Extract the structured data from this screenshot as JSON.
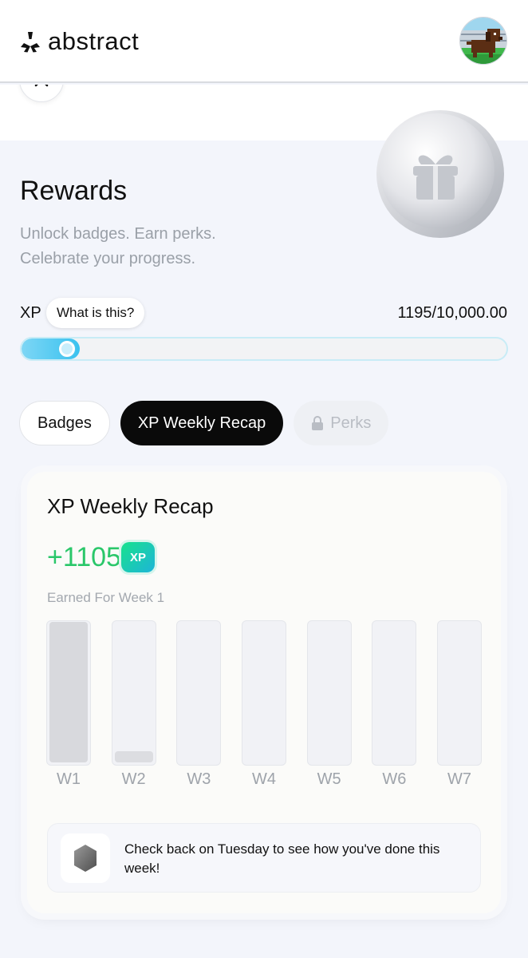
{
  "header": {
    "logo_text": "abstract"
  },
  "hero": {
    "title": "Rewards",
    "subtitle_line1": "Unlock badges. Earn perks.",
    "subtitle_line2": "Celebrate your progress."
  },
  "xp": {
    "label": "XP",
    "help_label": "What is this?",
    "current": 1195,
    "max": 10000,
    "progress_text": "1195/10,000.00",
    "progress_fraction": 0.1195,
    "accent_color": "#3ac2ef"
  },
  "tabs": [
    {
      "label": "Badges",
      "state": "default"
    },
    {
      "label": "XP Weekly Recap",
      "state": "active"
    },
    {
      "label": "Perks",
      "state": "locked",
      "icon": "lock-icon"
    }
  ],
  "recap": {
    "title": "XP Weekly Recap",
    "earned_value": "+1105",
    "badge_label": "XP",
    "earned_for": "Earned For Week 1",
    "earned_color": "#2ac76a",
    "weeks": [
      {
        "label": "W1",
        "fill": 1.0
      },
      {
        "label": "W2",
        "fill": 0.08
      },
      {
        "label": "W3",
        "fill": 0
      },
      {
        "label": "W4",
        "fill": 0
      },
      {
        "label": "W5",
        "fill": 0
      },
      {
        "label": "W6",
        "fill": 0
      },
      {
        "label": "W7",
        "fill": 0
      }
    ],
    "notice": "Check back on Tuesday to see how you've done this week!"
  }
}
